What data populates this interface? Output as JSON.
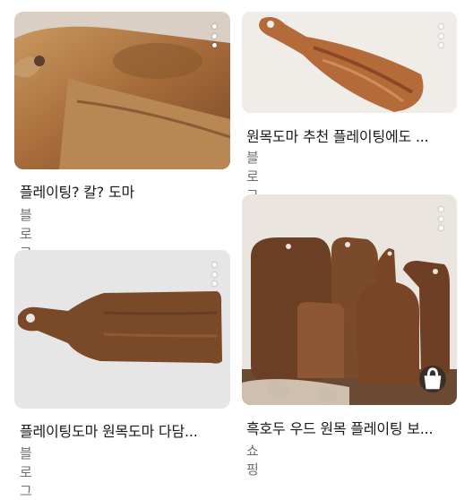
{
  "results": [
    {
      "title": "플레이팅? 칼? 도마",
      "source": "블로그"
    },
    {
      "title": "원목도마 추천 플레이팅에도 ...",
      "source": "블로그"
    },
    {
      "title": "플레이팅도마 원목도마 다담...",
      "source": "블로그"
    },
    {
      "title": "흑호두 우드 원목 플레이팅 보...",
      "source": "쇼핑"
    }
  ],
  "colors": {
    "wood_light": "#c79a5e",
    "wood_dark": "#5a3620",
    "surface": "#ece7e2"
  }
}
